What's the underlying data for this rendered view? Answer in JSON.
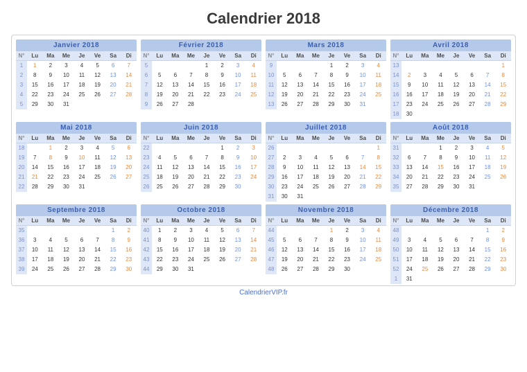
{
  "title": "Calendrier 2018",
  "footer": "CalendrierVIP.fr",
  "dow_header": [
    "N°",
    "Lu",
    "Ma",
    "Me",
    "Je",
    "Ve",
    "Sa",
    "Di"
  ],
  "months": [
    {
      "name": "Janvier 2018",
      "weeks": [
        {
          "wn": "1",
          "d": [
            "1",
            "2",
            "3",
            "4",
            "5",
            "6",
            "7"
          ],
          "hol": [
            0
          ]
        },
        {
          "wn": "2",
          "d": [
            "8",
            "9",
            "10",
            "11",
            "12",
            "13",
            "14"
          ]
        },
        {
          "wn": "3",
          "d": [
            "15",
            "16",
            "17",
            "18",
            "19",
            "20",
            "21"
          ]
        },
        {
          "wn": "4",
          "d": [
            "22",
            "23",
            "24",
            "25",
            "26",
            "27",
            "28"
          ]
        },
        {
          "wn": "5",
          "d": [
            "29",
            "30",
            "31",
            "",
            "",
            "",
            ""
          ]
        }
      ]
    },
    {
      "name": "Février 2018",
      "weeks": [
        {
          "wn": "5",
          "d": [
            "",
            "",
            "",
            "1",
            "2",
            "3",
            "4"
          ]
        },
        {
          "wn": "6",
          "d": [
            "5",
            "6",
            "7",
            "8",
            "9",
            "10",
            "11"
          ]
        },
        {
          "wn": "7",
          "d": [
            "12",
            "13",
            "14",
            "15",
            "16",
            "17",
            "18"
          ]
        },
        {
          "wn": "8",
          "d": [
            "19",
            "20",
            "21",
            "22",
            "23",
            "24",
            "25"
          ]
        },
        {
          "wn": "9",
          "d": [
            "26",
            "27",
            "28",
            "",
            "",
            "",
            ""
          ]
        }
      ]
    },
    {
      "name": "Mars 2018",
      "weeks": [
        {
          "wn": "9",
          "d": [
            "",
            "",
            "",
            "1",
            "2",
            "3",
            "4"
          ]
        },
        {
          "wn": "10",
          "d": [
            "5",
            "6",
            "7",
            "8",
            "9",
            "10",
            "11"
          ]
        },
        {
          "wn": "11",
          "d": [
            "12",
            "13",
            "14",
            "15",
            "16",
            "17",
            "18"
          ]
        },
        {
          "wn": "12",
          "d": [
            "19",
            "20",
            "21",
            "22",
            "23",
            "24",
            "25"
          ]
        },
        {
          "wn": "13",
          "d": [
            "26",
            "27",
            "28",
            "29",
            "30",
            "31",
            ""
          ]
        }
      ]
    },
    {
      "name": "Avril 2018",
      "weeks": [
        {
          "wn": "13",
          "d": [
            "",
            "",
            "",
            "",
            "",
            "",
            "1"
          ]
        },
        {
          "wn": "14",
          "d": [
            "2",
            "3",
            "4",
            "5",
            "6",
            "7",
            "8"
          ],
          "hol": [
            0
          ]
        },
        {
          "wn": "15",
          "d": [
            "9",
            "10",
            "11",
            "12",
            "13",
            "14",
            "15"
          ]
        },
        {
          "wn": "16",
          "d": [
            "16",
            "17",
            "18",
            "19",
            "20",
            "21",
            "22"
          ]
        },
        {
          "wn": "17",
          "d": [
            "23",
            "24",
            "25",
            "26",
            "27",
            "28",
            "29"
          ]
        },
        {
          "wn": "18",
          "d": [
            "30",
            "",
            "",
            "",
            "",
            "",
            ""
          ]
        }
      ]
    },
    {
      "name": "Mai 2018",
      "weeks": [
        {
          "wn": "18",
          "d": [
            "",
            "1",
            "2",
            "3",
            "4",
            "5",
            "6"
          ],
          "hol": [
            1
          ]
        },
        {
          "wn": "19",
          "d": [
            "7",
            "8",
            "9",
            "10",
            "11",
            "12",
            "13"
          ],
          "hol": [
            1,
            3
          ]
        },
        {
          "wn": "20",
          "d": [
            "14",
            "15",
            "16",
            "17",
            "18",
            "19",
            "20"
          ]
        },
        {
          "wn": "21",
          "d": [
            "21",
            "22",
            "23",
            "24",
            "25",
            "26",
            "27"
          ],
          "hol": [
            0
          ]
        },
        {
          "wn": "22",
          "d": [
            "28",
            "29",
            "30",
            "31",
            "",
            "",
            ""
          ]
        }
      ]
    },
    {
      "name": "Juin 2018",
      "weeks": [
        {
          "wn": "22",
          "d": [
            "",
            "",
            "",
            "",
            "1",
            "2",
            "3"
          ]
        },
        {
          "wn": "23",
          "d": [
            "4",
            "5",
            "6",
            "7",
            "8",
            "9",
            "10"
          ]
        },
        {
          "wn": "24",
          "d": [
            "11",
            "12",
            "13",
            "14",
            "15",
            "16",
            "17"
          ]
        },
        {
          "wn": "25",
          "d": [
            "18",
            "19",
            "20",
            "21",
            "22",
            "23",
            "24"
          ]
        },
        {
          "wn": "26",
          "d": [
            "25",
            "26",
            "27",
            "28",
            "29",
            "30",
            ""
          ]
        }
      ]
    },
    {
      "name": "Juillet 2018",
      "weeks": [
        {
          "wn": "26",
          "d": [
            "",
            "",
            "",
            "",
            "",
            "",
            "1"
          ]
        },
        {
          "wn": "27",
          "d": [
            "2",
            "3",
            "4",
            "5",
            "6",
            "7",
            "8"
          ]
        },
        {
          "wn": "28",
          "d": [
            "9",
            "10",
            "11",
            "12",
            "13",
            "14",
            "15"
          ],
          "hol": [
            5
          ]
        },
        {
          "wn": "29",
          "d": [
            "16",
            "17",
            "18",
            "19",
            "20",
            "21",
            "22"
          ]
        },
        {
          "wn": "30",
          "d": [
            "23",
            "24",
            "25",
            "26",
            "27",
            "28",
            "29"
          ]
        },
        {
          "wn": "31",
          "d": [
            "30",
            "31",
            "",
            "",
            "",
            "",
            ""
          ]
        }
      ]
    },
    {
      "name": "Août 2018",
      "weeks": [
        {
          "wn": "31",
          "d": [
            "",
            "",
            "1",
            "2",
            "3",
            "4",
            "5"
          ]
        },
        {
          "wn": "32",
          "d": [
            "6",
            "7",
            "8",
            "9",
            "10",
            "11",
            "12"
          ]
        },
        {
          "wn": "33",
          "d": [
            "13",
            "14",
            "15",
            "16",
            "17",
            "18",
            "19"
          ],
          "hol": [
            2
          ]
        },
        {
          "wn": "34",
          "d": [
            "20",
            "21",
            "22",
            "23",
            "24",
            "25",
            "26"
          ]
        },
        {
          "wn": "35",
          "d": [
            "27",
            "28",
            "29",
            "30",
            "31",
            "",
            ""
          ]
        }
      ]
    },
    {
      "name": "Septembre 2018",
      "weeks": [
        {
          "wn": "35",
          "d": [
            "",
            "",
            "",
            "",
            "",
            "1",
            "2"
          ]
        },
        {
          "wn": "36",
          "d": [
            "3",
            "4",
            "5",
            "6",
            "7",
            "8",
            "9"
          ]
        },
        {
          "wn": "37",
          "d": [
            "10",
            "11",
            "12",
            "13",
            "14",
            "15",
            "16"
          ]
        },
        {
          "wn": "38",
          "d": [
            "17",
            "18",
            "19",
            "20",
            "21",
            "22",
            "23"
          ]
        },
        {
          "wn": "39",
          "d": [
            "24",
            "25",
            "26",
            "27",
            "28",
            "29",
            "30"
          ]
        }
      ]
    },
    {
      "name": "Octobre 2018",
      "weeks": [
        {
          "wn": "40",
          "d": [
            "1",
            "2",
            "3",
            "4",
            "5",
            "6",
            "7"
          ]
        },
        {
          "wn": "41",
          "d": [
            "8",
            "9",
            "10",
            "11",
            "12",
            "13",
            "14"
          ]
        },
        {
          "wn": "42",
          "d": [
            "15",
            "16",
            "17",
            "18",
            "19",
            "20",
            "21"
          ]
        },
        {
          "wn": "43",
          "d": [
            "22",
            "23",
            "24",
            "25",
            "26",
            "27",
            "28"
          ]
        },
        {
          "wn": "44",
          "d": [
            "29",
            "30",
            "31",
            "",
            "",
            "",
            ""
          ]
        }
      ]
    },
    {
      "name": "Novembre 2018",
      "weeks": [
        {
          "wn": "44",
          "d": [
            "",
            "",
            "",
            "1",
            "2",
            "3",
            "4"
          ],
          "hol": [
            3
          ]
        },
        {
          "wn": "45",
          "d": [
            "5",
            "6",
            "7",
            "8",
            "9",
            "10",
            "11"
          ],
          "hol": [
            6
          ]
        },
        {
          "wn": "46",
          "d": [
            "12",
            "13",
            "14",
            "15",
            "16",
            "17",
            "18"
          ]
        },
        {
          "wn": "47",
          "d": [
            "19",
            "20",
            "21",
            "22",
            "23",
            "24",
            "25"
          ]
        },
        {
          "wn": "48",
          "d": [
            "26",
            "27",
            "28",
            "29",
            "30",
            "",
            ""
          ]
        }
      ]
    },
    {
      "name": "Décembre 2018",
      "weeks": [
        {
          "wn": "48",
          "d": [
            "",
            "",
            "",
            "",
            "",
            "1",
            "2"
          ]
        },
        {
          "wn": "49",
          "d": [
            "3",
            "4",
            "5",
            "6",
            "7",
            "8",
            "9"
          ]
        },
        {
          "wn": "50",
          "d": [
            "10",
            "11",
            "12",
            "13",
            "14",
            "15",
            "16"
          ]
        },
        {
          "wn": "51",
          "d": [
            "17",
            "18",
            "19",
            "20",
            "21",
            "22",
            "23"
          ]
        },
        {
          "wn": "52",
          "d": [
            "24",
            "25",
            "26",
            "27",
            "28",
            "29",
            "30"
          ],
          "hol": [
            1
          ]
        },
        {
          "wn": "1",
          "d": [
            "31",
            "",
            "",
            "",
            "",
            "",
            ""
          ]
        }
      ]
    }
  ]
}
